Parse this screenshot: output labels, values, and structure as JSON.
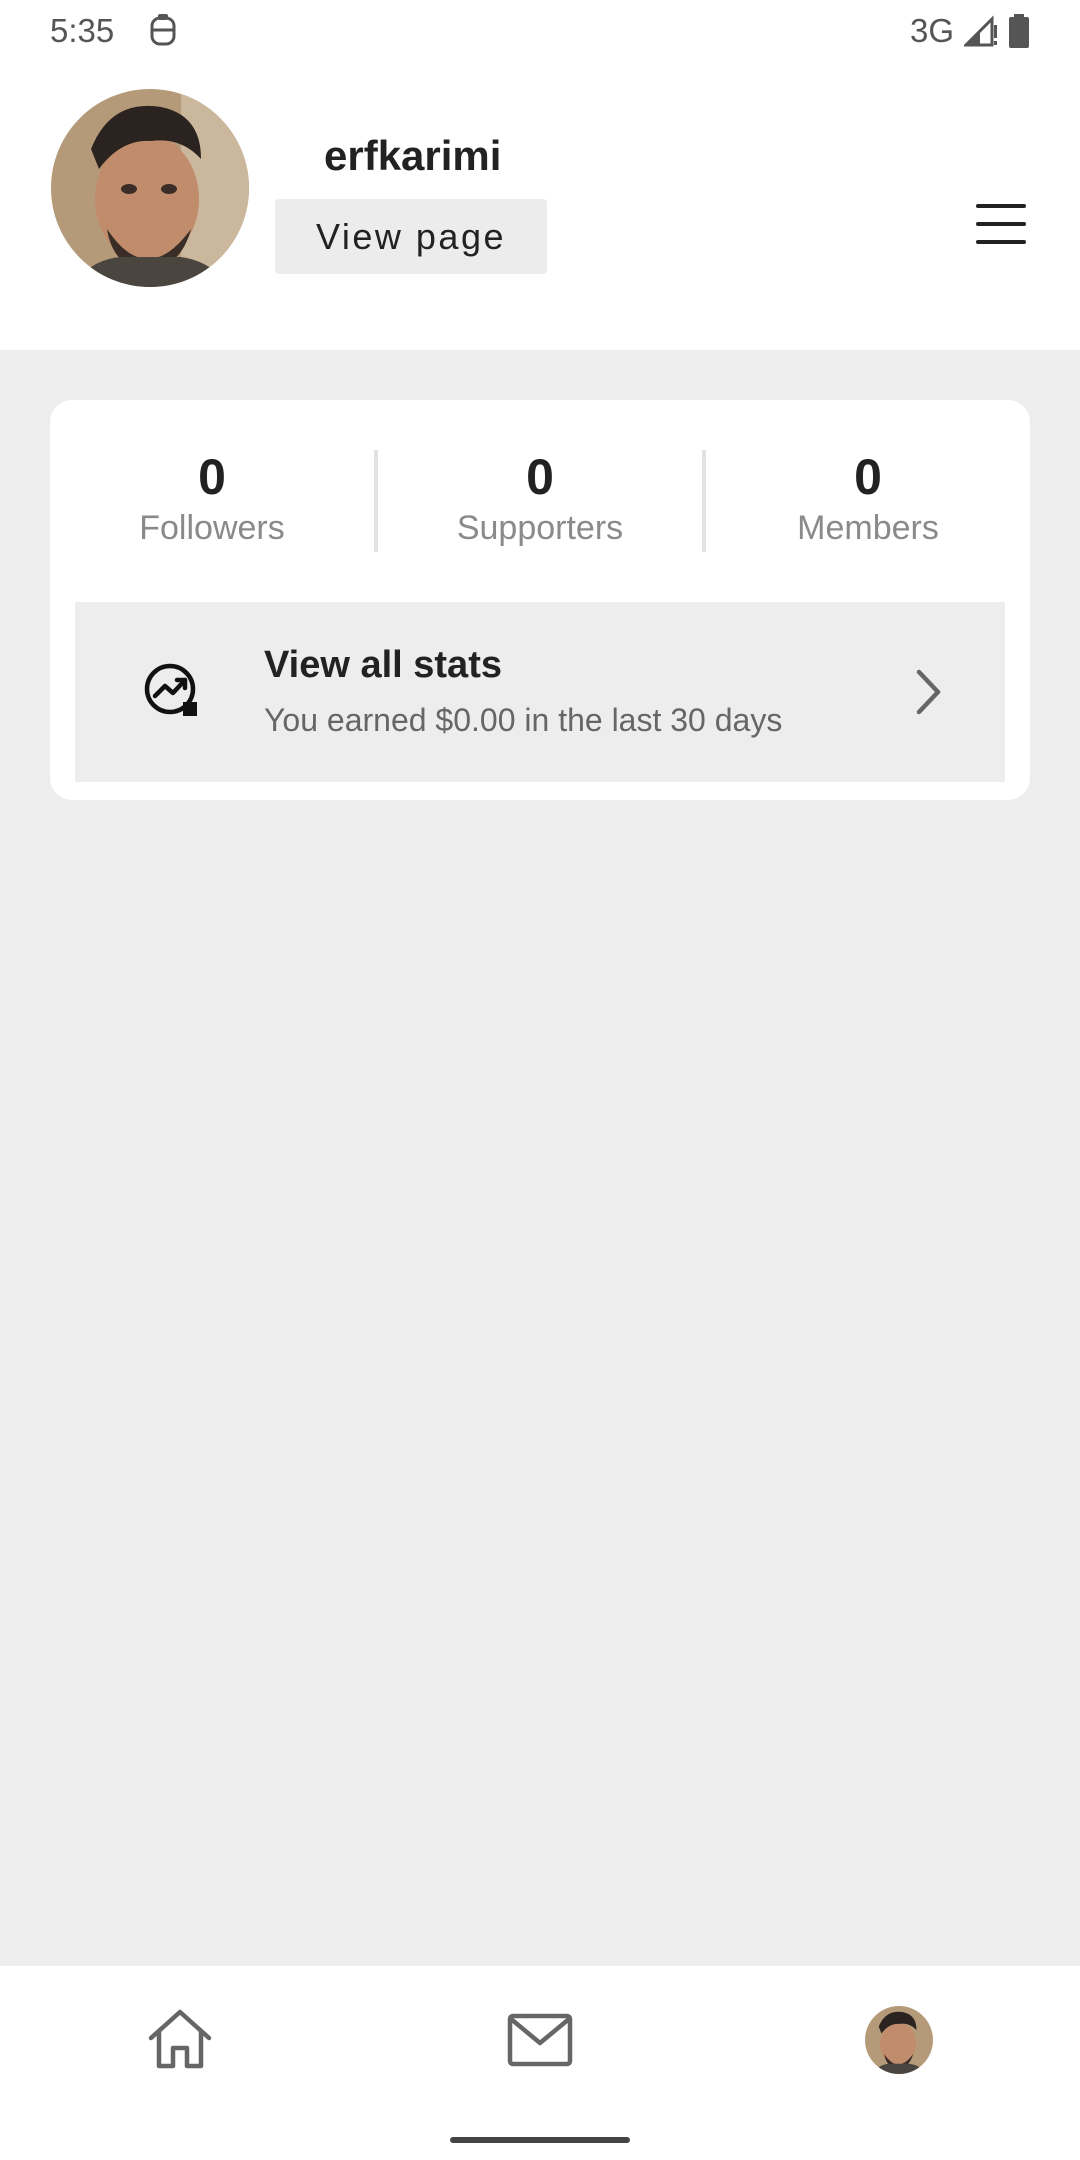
{
  "status_bar": {
    "time": "5:35",
    "network": "3G",
    "icons": [
      "notification-app-icon",
      "signal-icon",
      "battery-icon"
    ]
  },
  "header": {
    "username": "erfkarimi",
    "view_page_label": "View page",
    "avatar": "profile-photo",
    "menu_icon": "hamburger-menu-icon"
  },
  "stats": {
    "items": [
      {
        "value": "0",
        "label": "Followers"
      },
      {
        "value": "0",
        "label": "Supporters"
      },
      {
        "value": "0",
        "label": "Members"
      }
    ],
    "view_all_title": "View all stats",
    "view_all_subtitle": "You earned $0.00 in the last 30 days",
    "icon": "stats-chart-icon"
  },
  "bottom_nav": {
    "items": [
      "home-icon",
      "mail-icon",
      "profile-avatar"
    ]
  },
  "colors": {
    "background": "#ededed",
    "surface": "#ffffff",
    "text_primary": "#222222",
    "text_secondary": "#8a8a8a",
    "button_bg": "#ececec"
  }
}
